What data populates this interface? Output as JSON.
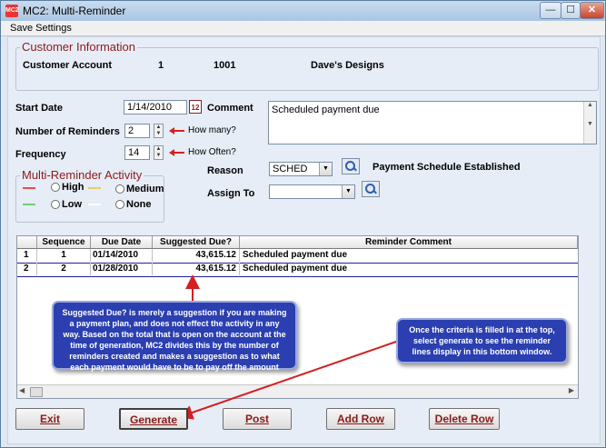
{
  "window": {
    "app_icon": "MC2",
    "title": "MC2: Multi-Reminder",
    "controls": {
      "minimize": "—",
      "maximize": "☐",
      "close": "✕"
    }
  },
  "menu": {
    "save_settings": "Save Settings"
  },
  "customer": {
    "group_title": "Customer Information",
    "account_label": "Customer Account",
    "account_num1": "1",
    "account_num2": "1001",
    "account_name": "Dave's Designs"
  },
  "form": {
    "start_date_label": "Start Date",
    "start_date_value": "1/14/2010",
    "calendar_icon": "12",
    "comment_label": "Comment",
    "comment_value": "Scheduled payment due",
    "reminders_label": "Number of Reminders",
    "reminders_value": "2",
    "reminders_hint": "How many?",
    "frequency_label": "Frequency",
    "frequency_value": "14",
    "frequency_hint": "How Often?",
    "reason_label": "Reason",
    "reason_value": "SCHED",
    "reason_description": "Payment Schedule Established",
    "assign_label": "Assign To",
    "assign_value": ""
  },
  "activity": {
    "group_title": "Multi-Reminder Activity",
    "high": "High",
    "medium": "Medium",
    "low": "Low",
    "none": "None"
  },
  "grid": {
    "headers": [
      "Sequence",
      "Due Date",
      "Suggested Due?",
      "Reminder Comment"
    ],
    "rows": [
      {
        "num": "1",
        "seq": "1",
        "due": "01/14/2010",
        "amount": "43,615.12",
        "comment": "Scheduled payment due"
      },
      {
        "num": "2",
        "seq": "2",
        "due": "01/28/2010",
        "amount": "43,615.12",
        "comment": "Scheduled payment due"
      }
    ]
  },
  "notes": {
    "suggested": "Suggested Due? is merely a suggestion if you are making a payment plan, and does not effect the activity in any way. Based on the total that is open on the account at the time of generation, MC2 divides this by the number of reminders created and makes a suggestion as to what each payment would have to be to pay off the amount owed.",
    "generate": "Once the criteria is filled in at the top, select generate to see the reminder lines display in this bottom window."
  },
  "buttons": {
    "exit": "Exit",
    "generate": "Generate",
    "post": "Post",
    "add_row": "Add Row",
    "delete_row": "Delete Row"
  },
  "colors": {
    "high": "#e05050",
    "medium": "#e0d070",
    "low": "#70d070",
    "none": "#ffffff",
    "note_bg": "#2b3fb0",
    "arrow": "#d42020",
    "label_red": "#8b1a1a"
  }
}
